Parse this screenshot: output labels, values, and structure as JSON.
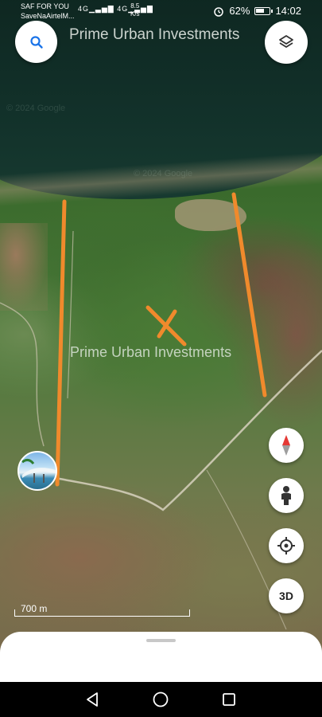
{
  "status_bar": {
    "carrier_line1": "SAF FOR YOU",
    "carrier_line2": "SaveNaAirtelM...",
    "signal_text": "4G▁▃▅▇ 4G▁▃▅▇",
    "speed_value": "8.5",
    "speed_unit": "K/s",
    "battery_percent": "62%",
    "time": "14:02"
  },
  "map": {
    "title_overlay": "Prime Urban Investments",
    "center_watermark": "Prime Urban Investments",
    "faint_watermark": "© 2024 Google",
    "scale_label": "700 m"
  },
  "controls": {
    "search_icon": "search-icon",
    "layers_icon": "layers-icon",
    "compass_icon": "compass-icon",
    "pegman_icon": "pegman-icon",
    "locate_icon": "my-location-icon",
    "threed_label": "3D"
  },
  "colors": {
    "marker_orange": "#f08a2c",
    "button_blue": "#1a73e8"
  }
}
